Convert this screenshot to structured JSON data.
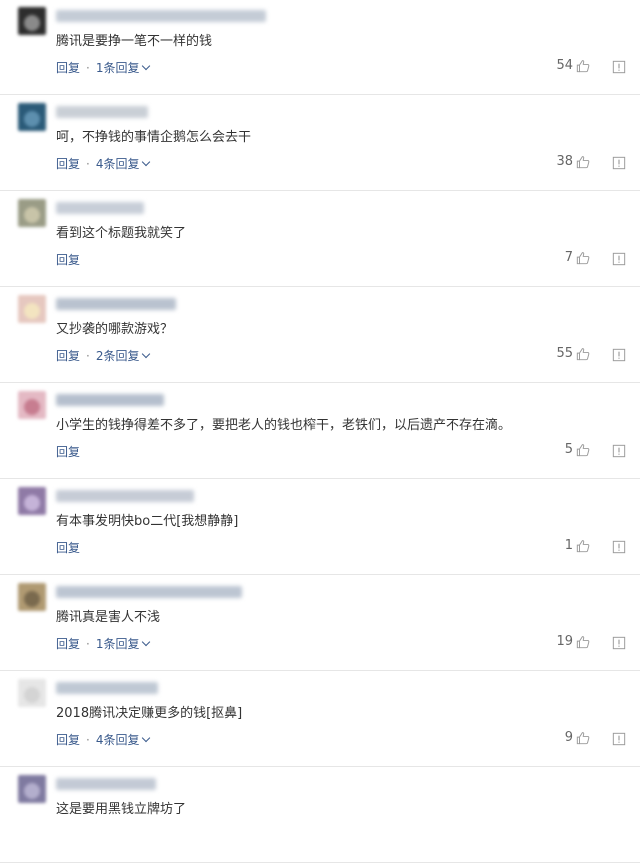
{
  "comments": [
    {
      "text": "腾讯是要挣一笔不一样的钱",
      "reply_label": "回复",
      "replies_label": "1条回复",
      "likes": "54",
      "colors": {
        "avatar_bg": "#2d2d2d",
        "avatar_fg": "#8a8a8a",
        "name": "#c4ccd6",
        "tail": "#dddddd"
      }
    },
    {
      "text": "呵，不挣钱的事情企鹅怎么会去干",
      "reply_label": "回复",
      "replies_label": "4条回复",
      "likes": "38",
      "colors": {
        "avatar_bg": "#2a5a78",
        "avatar_fg": "#5d8fae",
        "name": "#c9cfd6",
        "tail": "#dddddd"
      }
    },
    {
      "text": "看到这个标题我就笑了",
      "reply_label": "回复",
      "replies_label": "",
      "likes": "7",
      "colors": {
        "avatar_bg": "#9a9c86",
        "avatar_fg": "#c8c4a8",
        "name": "#c7ced8",
        "tail": "#dddddd"
      }
    },
    {
      "text": "又抄袭的哪款游戏？",
      "reply_label": "回复",
      "replies_label": "2条回复",
      "likes": "55",
      "colors": {
        "avatar_bg": "#e6c8c0",
        "avatar_fg": "#f3e4c0",
        "name": "#b9c2cf",
        "tail": "#dedede"
      }
    },
    {
      "text": "小学生的钱挣得差不多了，要把老人的钱也榨干，老铁们，以后遗产不存在滴。",
      "reply_label": "回复",
      "replies_label": "",
      "likes": "5",
      "colors": {
        "avatar_bg": "#e4b9c4",
        "avatar_fg": "#c77d90",
        "name": "#b5bfcd",
        "tail": "#dddddd"
      }
    },
    {
      "text": "有本事发明快bo二代[我想静静]",
      "reply_label": "回复",
      "replies_label": "",
      "likes": "1",
      "colors": {
        "avatar_bg": "#8f7aa6",
        "avatar_fg": "#c5b3d8",
        "name": "#c6ccd6",
        "tail": "#dddddd"
      }
    },
    {
      "text": "腾讯真是害人不浅",
      "reply_label": "回复",
      "replies_label": "1条回复",
      "likes": "19",
      "colors": {
        "avatar_bg": "#b09a72",
        "avatar_fg": "#7a6a4e",
        "name": "#bcc5d2",
        "tail": "#d2d2d2"
      }
    },
    {
      "text": "2018腾讯决定赚更多的钱[抠鼻]",
      "reply_label": "回复",
      "replies_label": "4条回复",
      "likes": "9",
      "colors": {
        "avatar_bg": "#e6e6e6",
        "avatar_fg": "#d4d4d4",
        "name": "#bfc8d4",
        "tail": "#dddddd"
      }
    },
    {
      "text": "这是要用黑钱立牌坊了",
      "reply_label": "",
      "replies_label": "",
      "likes": "",
      "colors": {
        "avatar_bg": "#7f7aa0",
        "avatar_fg": "#b3aecd",
        "name": "#c3cad5",
        "tail": "#dddddd"
      }
    }
  ],
  "icons": {
    "like": "thumbs-up-icon",
    "report": "report-icon",
    "expand": "chevron-down-icon"
  },
  "colors": {
    "link": "#3a5a8c",
    "text": "#333333",
    "count": "#666666",
    "divider": "#e6e6e6"
  }
}
